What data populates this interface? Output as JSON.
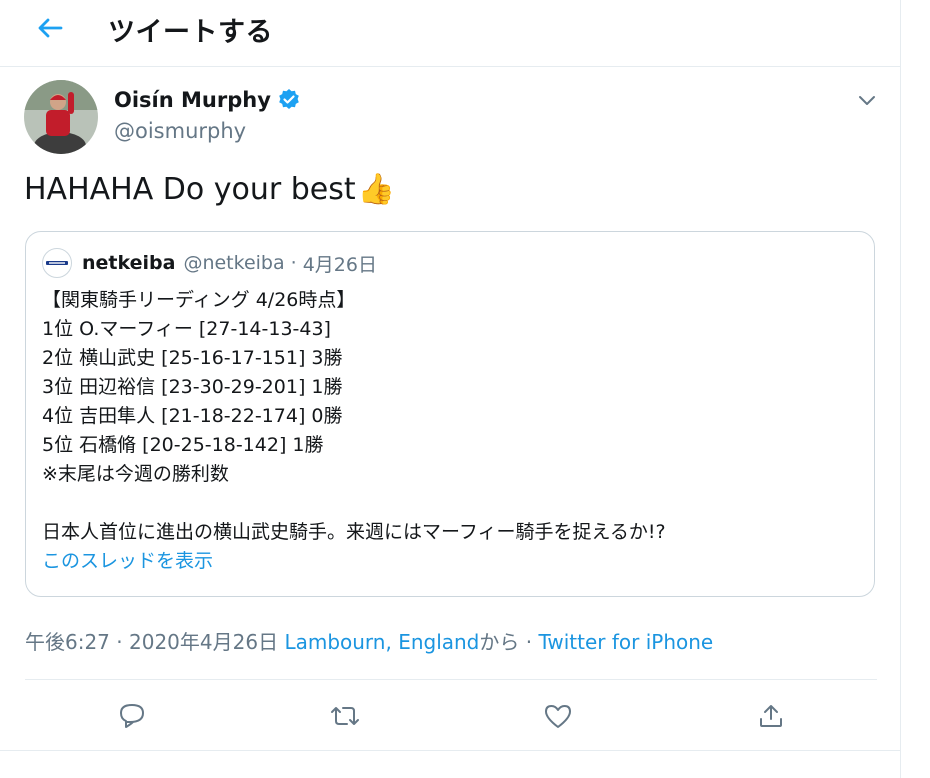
{
  "header": {
    "title": "ツイートする",
    "back_icon": "arrow-left-icon"
  },
  "tweet": {
    "display_name": "Oisín Murphy",
    "handle": "@oismurphy",
    "verified": true,
    "text": "HAHAHA Do your best",
    "emoji": "👍",
    "menu_icon": "chevron-down-icon"
  },
  "quote": {
    "name": "netkeiba",
    "handle": "@netkeiba",
    "separator": "·",
    "date": "4月26日",
    "lines": [
      "【関東騎手リーディング 4/26時点】",
      "1位 O.マーフィー [27-14-13-43]",
      "2位 横山武史 [25-16-17-151] 3勝",
      "3位 田辺裕信 [23-30-29-201] 1勝",
      "4位 吉田隼人 [21-18-22-174] 0勝",
      "5位 石橋脩 [20-25-18-142] 1勝",
      "※末尾は今週の勝利数",
      "",
      "日本人首位に進出の横山武史騎手。来週にはマーフィー騎手を捉えるか!?"
    ],
    "thread_link": "このスレッドを表示"
  },
  "meta": {
    "time": "午後6:27",
    "separator": "·",
    "date": "2020年4月26日",
    "location": "Lambourn, England",
    "from_suffix": "から",
    "source": "Twitter for iPhone"
  },
  "actions": {
    "reply_icon": "reply-icon",
    "retweet_icon": "retweet-icon",
    "like_icon": "heart-icon",
    "share_icon": "share-icon"
  },
  "colors": {
    "accent": "#1da1f2",
    "link": "#1b95e0",
    "secondary_text": "#657786",
    "border": "#e6ecf0"
  }
}
